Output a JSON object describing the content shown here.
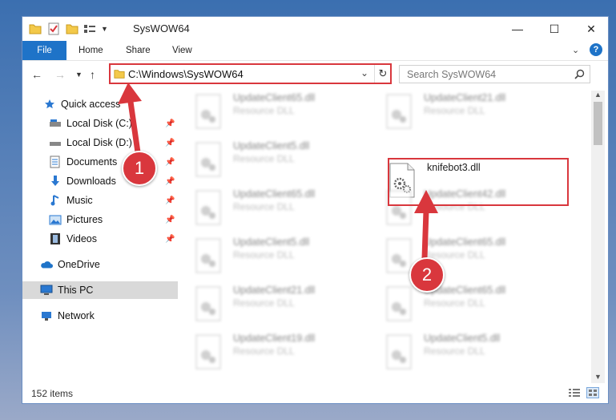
{
  "window": {
    "title": "SysWOW64",
    "minimize": "—",
    "maximize": "☐",
    "close": "✕",
    "help": "?"
  },
  "ribbon": {
    "tabs": [
      "File",
      "Home",
      "Share",
      "View"
    ]
  },
  "address": {
    "path": "C:\\Windows\\SysWOW64",
    "search_placeholder": "Search SysWOW64"
  },
  "nav": {
    "items": [
      {
        "label": "Quick access",
        "icon": "star-icon"
      },
      {
        "label": "Local Disk (C:)",
        "icon": "drive-icon",
        "pinned": true
      },
      {
        "label": "Local Disk (D:)",
        "icon": "drive-icon",
        "pinned": true
      },
      {
        "label": "Documents",
        "icon": "documents-icon",
        "pinned": true
      },
      {
        "label": "Downloads",
        "icon": "download-icon",
        "pinned": true
      },
      {
        "label": "Music",
        "icon": "music-icon",
        "pinned": true
      },
      {
        "label": "Pictures",
        "icon": "pictures-icon",
        "pinned": true
      },
      {
        "label": "Videos",
        "icon": "videos-icon",
        "pinned": true
      },
      {
        "label": "OneDrive",
        "icon": "cloud-icon"
      },
      {
        "label": "This PC",
        "icon": "computer-icon",
        "selected": true
      },
      {
        "label": "Network",
        "icon": "network-icon"
      }
    ]
  },
  "files": {
    "left": [
      {
        "name": "UpdateClient65.dll",
        "type": "Resource DLL"
      },
      {
        "name": "UpdateClient5.dll",
        "type": "Resource DLL"
      },
      {
        "name": "UpdateClient65.dll",
        "type": "Resource DLL"
      },
      {
        "name": "UpdateClient5.dll",
        "type": "Resource DLL"
      },
      {
        "name": "UpdateClient21.dll",
        "type": "Resource DLL"
      },
      {
        "name": "UpdateClient19.dll",
        "type": "Resource DLL"
      }
    ],
    "right": [
      {
        "name": "UpdateClient21.dll",
        "type": "Resource DLL"
      },
      {
        "name": "knifebot3.dll",
        "type": "",
        "highlight": true
      },
      {
        "name": "UpdateClient42.dll",
        "type": "Resource DLL"
      },
      {
        "name": "UpdateClient65.dll",
        "type": "Resource DLL"
      },
      {
        "name": "UpdateClient65.dll",
        "type": "Resource DLL"
      },
      {
        "name": "UpdateClient5.dll",
        "type": "Resource DLL"
      }
    ]
  },
  "status": {
    "item_count": "152 items"
  },
  "annotations": {
    "step1": "1",
    "step2": "2",
    "color": "#d9373d"
  }
}
